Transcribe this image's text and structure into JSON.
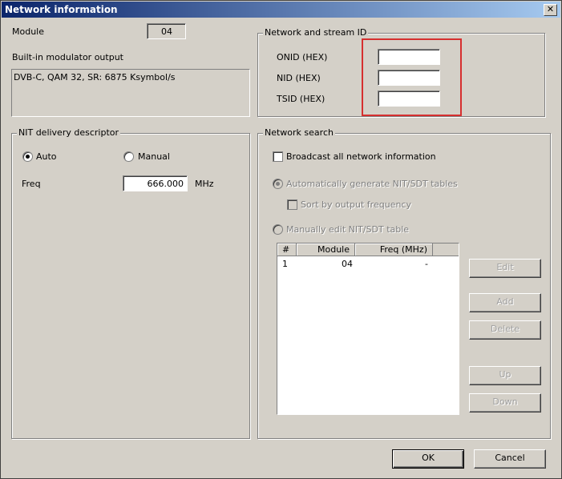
{
  "window": {
    "title": "Network information",
    "close_glyph": "✕"
  },
  "module": {
    "label": "Module",
    "value": "04"
  },
  "modulator": {
    "label": "Built-in modulator output",
    "text": "DVB-C, QAM 32, SR: 6875 Ksymbol/s"
  },
  "network_id": {
    "legend": "Network and stream ID",
    "onid_label": "ONID (HEX)",
    "onid_value": "",
    "nid_label": "NID (HEX)",
    "nid_value": "",
    "tsid_label": "TSID (HEX)",
    "tsid_value": "",
    "highlight_color": "#d62f2f"
  },
  "nit": {
    "legend": "NIT delivery descriptor",
    "auto_label": "Auto",
    "manual_label": "Manual",
    "selected": "Auto",
    "freq_label": "Freq",
    "freq_value": "666.000",
    "freq_unit": "MHz"
  },
  "network_search": {
    "legend": "Network search",
    "broadcast_label": "Broadcast all network information",
    "broadcast_checked": false,
    "auto_gen_label": "Automatically generate NIT/SDT tables",
    "sort_label": "Sort by output frequency",
    "manual_edit_label": "Manually edit NIT/SDT table",
    "table": {
      "columns": [
        "#",
        "Module",
        "Freq (MHz)"
      ],
      "rows": [
        {
          "num": "1",
          "module": "04",
          "freq": "-"
        }
      ]
    },
    "buttons": {
      "edit": "Edit",
      "add": "Add",
      "delete": "Delete",
      "up": "Up",
      "down": "Down"
    }
  },
  "dialog_buttons": {
    "ok": "OK",
    "cancel": "Cancel"
  }
}
